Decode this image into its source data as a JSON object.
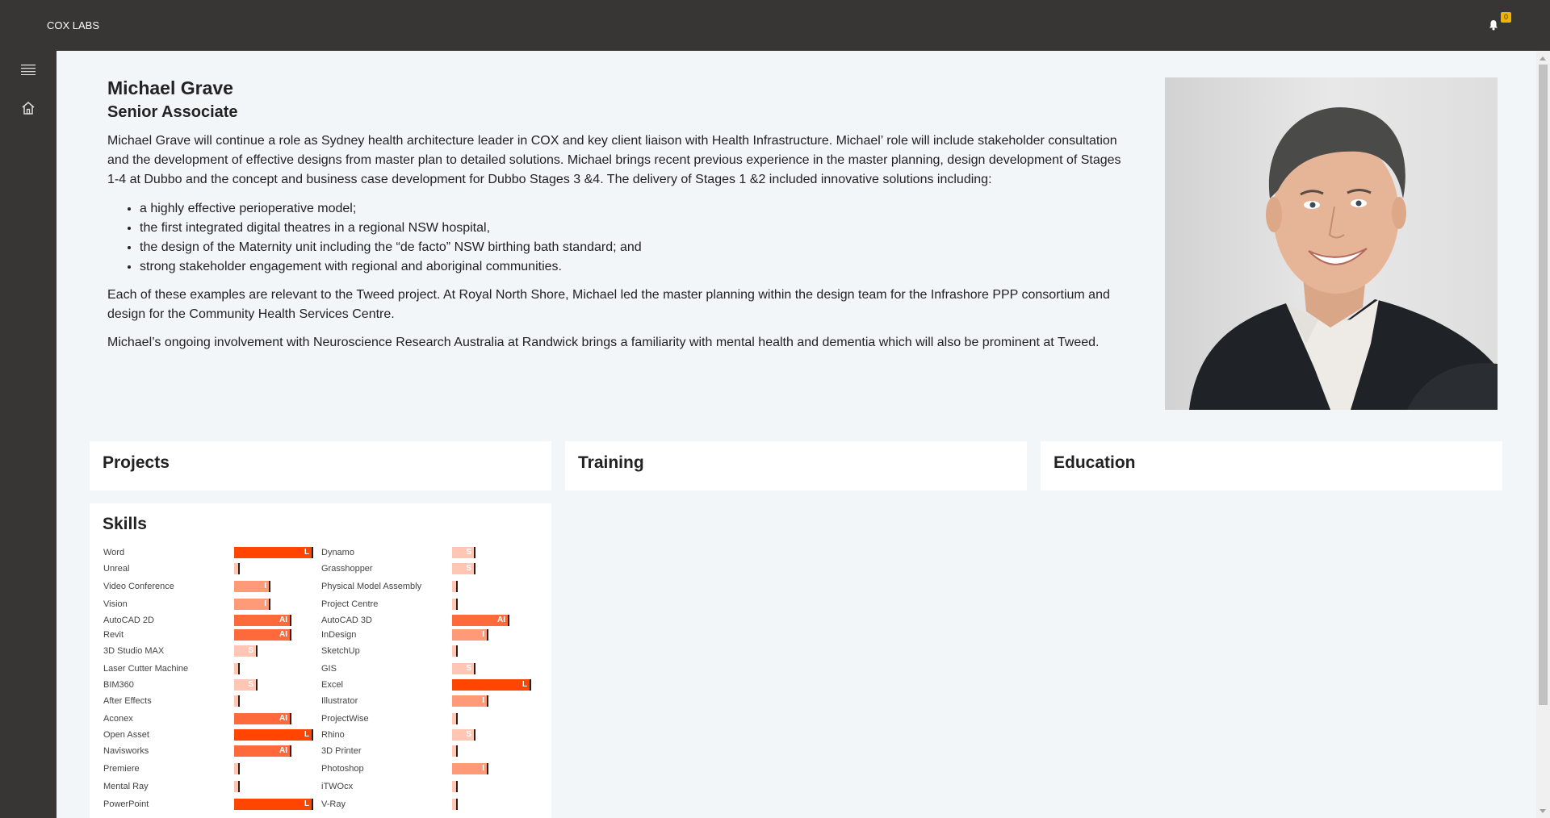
{
  "header": {
    "brand": "COX LABS",
    "notification_count": "0"
  },
  "profile": {
    "name": "Michael Grave",
    "title": "Senior Associate",
    "intro": "Michael Grave will continue a role as Sydney health architecture leader in COX and key client liaison with Health Infrastructure. Michael’ role will include stakeholder consultation and the development of effective designs from master plan to detailed solutions. Michael brings recent previous experience in the master planning, design development of Stages 1-4 at Dubbo and the concept and business case development for Dubbo Stages 3 &4. The delivery of Stages 1 &2 included innovative solutions including:",
    "bullets": [
      "a highly effective perioperative model;",
      "the first integrated digital theatres in a regional NSW hospital,",
      "the design of the Maternity unit including the “de facto” NSW birthing bath standard; and",
      "strong stakeholder engagement with regional and aboriginal communities."
    ],
    "para2": "Each of these examples are relevant to the Tweed project. At Royal North Shore, Michael led the master planning within the design team for the Infrashore PPP consortium and design for the Community Health Services Centre.",
    "para3": "Michael’s ongoing involvement with Neuroscience Research Australia at Randwick brings a familiarity with mental health and dementia which will also be prominent at Tweed."
  },
  "cards": {
    "projects": "Projects",
    "training": "Training",
    "education": "Education",
    "skills": "Skills"
  },
  "skill_levels": {
    "L": {
      "fraction": 1.0,
      "color": "#ff4500"
    },
    "AI": {
      "fraction": 0.72,
      "color": "#ff6a3d"
    },
    "I": {
      "fraction": 0.45,
      "color": "#ff9a78"
    },
    "S": {
      "fraction": 0.28,
      "color": "#ffc6b3"
    },
    "": {
      "fraction": 0.05,
      "color": "#ffc6b3"
    }
  },
  "skills": [
    {
      "name": "Word",
      "level": "L"
    },
    {
      "name": "Unreal",
      "level": ""
    },
    {
      "name": "Video Conference",
      "level": "I"
    },
    {
      "name": "Vision",
      "level": "I"
    },
    {
      "name": "AutoCAD 2D",
      "level": "AI"
    },
    {
      "name": "Revit",
      "level": "AI"
    },
    {
      "name": "3D Studio MAX",
      "level": "S"
    },
    {
      "name": "Laser Cutter Machine",
      "level": ""
    },
    {
      "name": "BIM360",
      "level": "S"
    },
    {
      "name": "After Effects",
      "level": ""
    },
    {
      "name": "Aconex",
      "level": "AI"
    },
    {
      "name": "Open Asset",
      "level": "L"
    },
    {
      "name": "Navisworks",
      "level": "AI"
    },
    {
      "name": "Premiere",
      "level": ""
    },
    {
      "name": "Mental Ray",
      "level": ""
    },
    {
      "name": "PowerPoint",
      "level": "L"
    },
    {
      "name": "Dynamo",
      "level": "S"
    },
    {
      "name": "Grasshopper",
      "level": "S"
    },
    {
      "name": "Physical Model Assembly",
      "level": ""
    },
    {
      "name": "Project Centre",
      "level": ""
    },
    {
      "name": "AutoCAD 3D",
      "level": "AI"
    },
    {
      "name": "InDesign",
      "level": "I"
    },
    {
      "name": "SketchUp",
      "level": ""
    },
    {
      "name": "GIS",
      "level": "S"
    },
    {
      "name": "Excel",
      "level": "L"
    },
    {
      "name": "Illustrator",
      "level": "I"
    },
    {
      "name": "ProjectWise",
      "level": ""
    },
    {
      "name": "Rhino",
      "level": "S"
    },
    {
      "name": "3D Printer",
      "level": ""
    },
    {
      "name": "Photoshop",
      "level": "I"
    },
    {
      "name": "iTWOcx",
      "level": ""
    },
    {
      "name": "V-Ray",
      "level": ""
    }
  ],
  "colors": {
    "topbar": "#373634",
    "accent": "#ff4500",
    "badge": "#f0b400",
    "page_bg": "#f2f6f9"
  }
}
